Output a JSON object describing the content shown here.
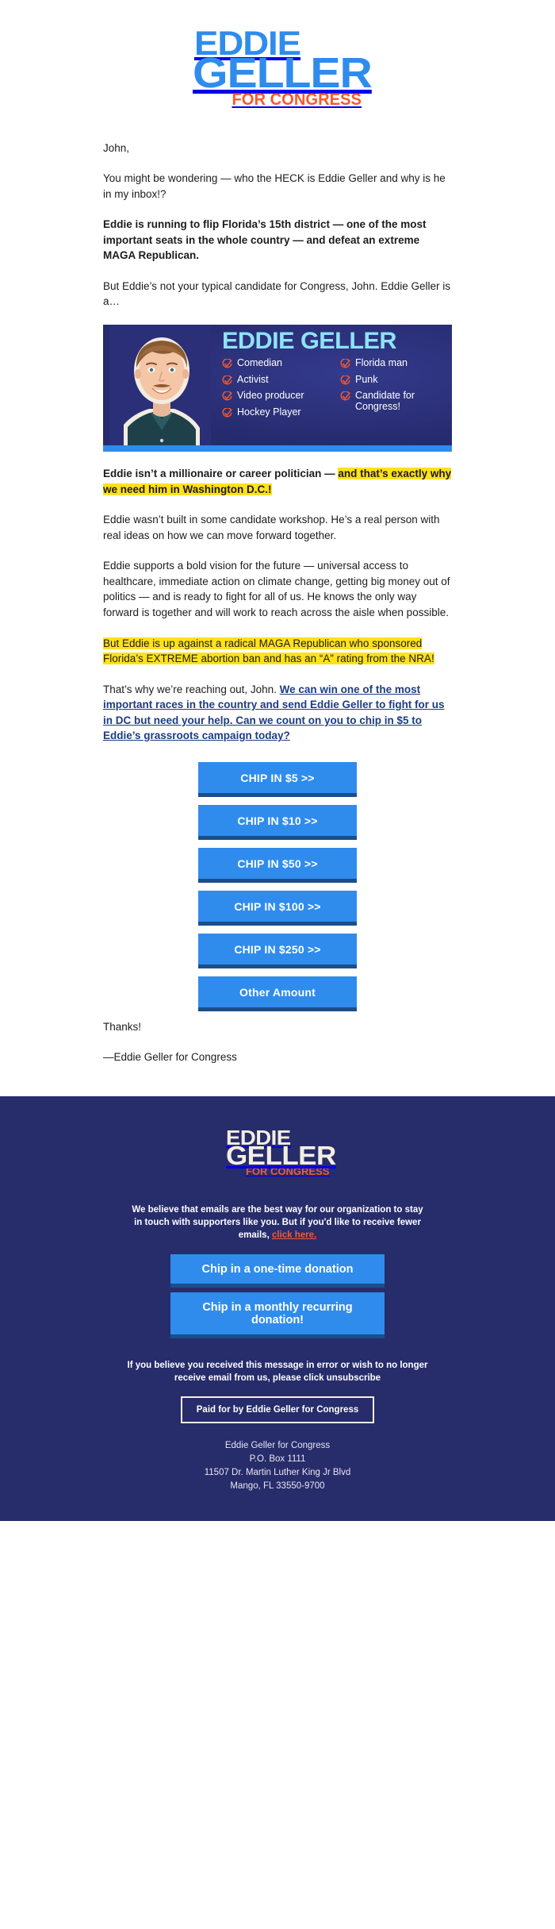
{
  "brand": {
    "logo_line1": "EDDIE",
    "logo_line2": "GELLER",
    "logo_tagline": "FOR CONGRESS",
    "blue": "#2f8ced",
    "orange": "#f95a2c",
    "navy": "#272c6b",
    "cream": "#f4eee1",
    "highlight_yellow": "#ffd400"
  },
  "email": {
    "greeting": "John,",
    "p1": "You might be wondering — who the HECK is Eddie Geller and why is he in my inbox!?",
    "p2_bold": "Eddie is running to flip Florida’s 15th district — one of the most important seats in the whole country — and defeat an extreme MAGA Republican.",
    "p3": "But Eddie’s not your typical candidate for Congress, John. Eddie Geller is a…",
    "p4_plain": "Eddie isn’t a millionaire or career politician — ",
    "p4_highlight": "and that’s exactly why we need him in Washington D.C.!",
    "p5": "Eddie wasn’t built in some candidate workshop. He’s a real person with real ideas on how we can move forward together.",
    "p6": "Eddie supports a bold vision for the future — universal access to healthcare, immediate action on climate change, getting big money out of politics — and is ready to fight for all of us. He knows the only way forward is together and will work to reach across the aisle when possible.",
    "p7_highlight": "But Eddie is up against a radical MAGA Republican who sponsored Florida’s EXTREME abortion ban and has an “A” rating from the NRA!",
    "p8_plain": "That’s why we’re reaching out, John. ",
    "p8_link": "We can win one of the most important races in the country and send Eddie Geller to fight for us in DC but need your help. Can we count on you to chip in $5 to Eddie’s grassroots campaign today?",
    "signoff_thanks": "Thanks!",
    "signoff_name": "—Eddie Geller for Congress"
  },
  "hero": {
    "title": "EDDIE GELLER",
    "alt": "Eddie Geller headshot",
    "checkmark_icon": "circled-check-icon",
    "left_items": [
      "Comedian",
      "Activist",
      "Video producer",
      "Hockey Player"
    ],
    "right_items": [
      "Florida man",
      "Punk",
      "Candidate for Congress!"
    ],
    "bg_color": "#272c6b",
    "title_color": "#8fe3f7",
    "check_color": "#f95a2c"
  },
  "donate_buttons": [
    "CHIP IN $5 >>",
    "CHIP IN $10 >>",
    "CHIP IN $50 >>",
    "CHIP IN $100 >>",
    "CHIP IN $250 >>",
    "Other Amount"
  ],
  "footer": {
    "logo_line1": "EDDIE",
    "logo_line2": "GELLER",
    "logo_tagline": "FOR CONGRESS",
    "note_text": "We believe that emails are the best way for our organization to stay in touch with supporters like you. But if you'd like to receive fewer emails, ",
    "note_link": "click here.",
    "btn_one_time": "Chip in a one-time donation",
    "btn_monthly": "Chip in a monthly recurring donation!",
    "unsubscribe_note": "If you believe you received this message in error or wish to no longer receive email from us, please click unsubscribe",
    "paid_for": "Paid for by Eddie Geller for Congress",
    "address_lines": [
      "Eddie Geller for Congress",
      "P.O. Box 1111",
      "11507 Dr. Martin Luther King Jr Blvd",
      "Mango, FL 33550-9700"
    ]
  }
}
